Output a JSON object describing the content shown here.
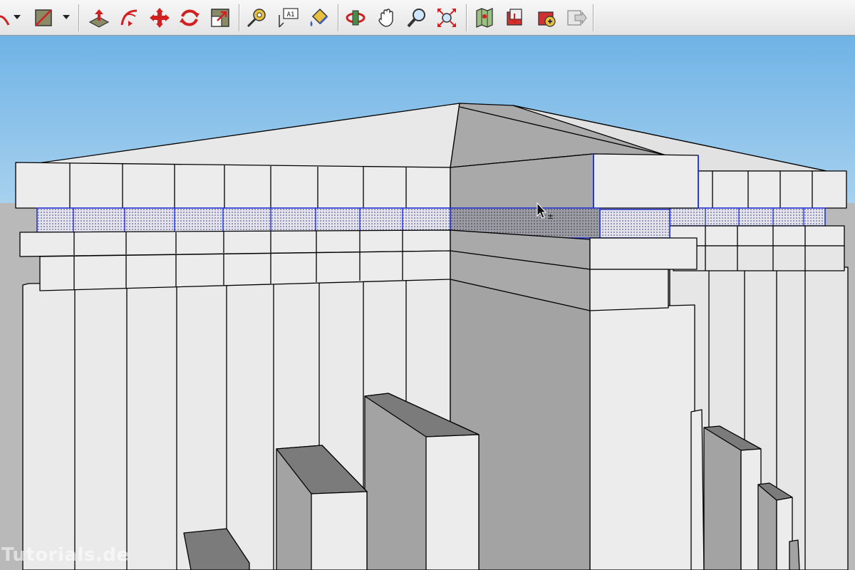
{
  "toolbar": {
    "tools": [
      {
        "name": "arc-tool",
        "icon": "arc-icon"
      },
      {
        "name": "rectangle-tool",
        "icon": "rectangle-icon"
      },
      {
        "name": "push-pull-tool",
        "icon": "push-pull-icon"
      },
      {
        "name": "follow-me-tool",
        "icon": "follow-me-icon"
      },
      {
        "name": "move-tool",
        "icon": "move-icon"
      },
      {
        "name": "rotate-tool",
        "icon": "rotate-icon"
      },
      {
        "name": "scale-tool",
        "icon": "scale-icon"
      },
      {
        "name": "tape-measure-tool",
        "icon": "tape-measure-icon"
      },
      {
        "name": "text-tool",
        "icon": "text-icon",
        "label": "A1"
      },
      {
        "name": "paint-bucket-tool",
        "icon": "paint-bucket-icon"
      },
      {
        "name": "orbit-tool",
        "icon": "orbit-icon"
      },
      {
        "name": "pan-tool",
        "icon": "pan-hand-icon"
      },
      {
        "name": "zoom-tool",
        "icon": "zoom-icon"
      },
      {
        "name": "zoom-extents-tool",
        "icon": "zoom-extents-icon"
      },
      {
        "name": "add-location-tool",
        "icon": "map-location-icon"
      },
      {
        "name": "get-models-tool",
        "icon": "get-models-icon"
      },
      {
        "name": "share-model-tool",
        "icon": "share-model-icon"
      },
      {
        "name": "send-to-layout-tool",
        "icon": "send-to-layout-icon"
      }
    ]
  },
  "viewport": {
    "sky_color": "#7fbbe7",
    "ground_color": "#b9b9b9",
    "selection_color": "#2233dd",
    "cursor": "move-cursor-icon"
  },
  "watermark": "Tutorials.de"
}
